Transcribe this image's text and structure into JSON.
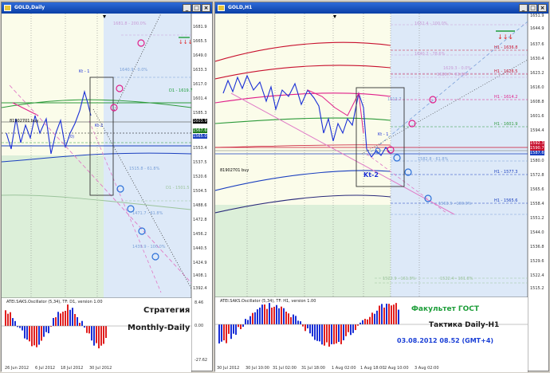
{
  "windows": {
    "left": {
      "title": "GOLD,Daily",
      "price_axis": [
        "1681.9",
        "1665.5",
        "1649.0",
        "1633.3",
        "1617.0",
        "1601.4",
        "1585.3",
        "1569.3",
        "1553.4",
        "1537.5",
        "1520.6",
        "1504.5",
        "1488.6",
        "1472.8",
        "1456.2",
        "1440.5",
        "1424.9",
        "1408.1",
        "1392.4"
      ],
      "time_axis": [
        "26 Jun 2012",
        "6 Jul 2012",
        "18 Jul 2012",
        "30 Jul 2012"
      ],
      "price_tags": [
        {
          "text": "1603.9",
          "color": "#000000"
        },
        {
          "text": "1567.6",
          "color": "#1f7a1f"
        },
        {
          "text": "1565.0",
          "color": "#1a3fbf"
        }
      ],
      "markers": [
        "1681.8 - 200.0%",
        "1640.9 - 0.0%",
        "D1 - 1619.7",
        "Kt - 1",
        "(0)",
        "1515.8 - 61.8%",
        "D1 - 1501.5",
        "1471.7 - 61.8%",
        "1439.9 - 100.0%",
        "81902701 buy"
      ],
      "kt_label": "Kt-2",
      "indicator": {
        "title": "ATEI.SAKS.Oscillator (5,34), TF: D1, version 1.00",
        "axis": [
          "8.46",
          "0.00",
          "-27.62"
        ]
      },
      "caption": [
        "Стратегия",
        "Monthly-Daily"
      ]
    },
    "right": {
      "title": "GOLD,H1",
      "price_axis": [
        "1651.9",
        "1644.9",
        "1637.6",
        "1630.4",
        "1623.2",
        "1616.0",
        "1608.8",
        "1601.6",
        "1594.4",
        "1587.2",
        "1580.0",
        "1572.8",
        "1565.6",
        "1558.4",
        "1551.2",
        "1544.0",
        "1536.8",
        "1529.6",
        "1522.4",
        "1515.2"
      ],
      "time_axis": [
        "30 Jul 2012",
        "30 Jul 10:00",
        "31 Jul 02:00",
        "31 Jul 18:00",
        "1 Aug 02:00",
        "1 Aug 18:00",
        "2 Aug 10:00",
        "3 Aug 02:00"
      ],
      "price_tags": [
        {
          "text": "1592.3",
          "color": "#c8102e"
        },
        {
          "text": "1590.7",
          "color": "#c8102e"
        },
        {
          "text": "1587.6",
          "color": "#1a3fbf"
        }
      ],
      "markers": [
        "1652.4 - 100.0%",
        "1640.2 - 78.6%",
        "1629.3 - 0.0%",
        "1626.7 - 61.8%",
        "H1 - 1636.8",
        "H1 - 1626.5",
        "H1 - 1614.2",
        "1613.7",
        "H1 - 1601.9",
        "Kt - 1",
        "1582.8 - 61.8%",
        "H1 - 1577.3",
        "H1 - 1565.6",
        "1563.5 - 100.0%",
        "1522.9 - 161.8%",
        "1522.4 - 161.8%",
        "81902701 buy"
      ],
      "kt_label": "Kt-2",
      "indicator": {
        "title": "ATEI.SAKS.Oscillator (5,34), TF: H1, version 1.00"
      },
      "caption": {
        "faculty": "Факультет ГОСТ",
        "tactic": "Тактика Daily-H1",
        "datetime": "03.08.2012   08.52 (GMT+4)"
      }
    }
  },
  "colors": {
    "faculty": "#1e9e3a",
    "tactic": "#1a1a1a",
    "datetime": "#1a3fd6",
    "bull_bar": "#1a2fd6",
    "bear_bar": "#e01f1f"
  }
}
